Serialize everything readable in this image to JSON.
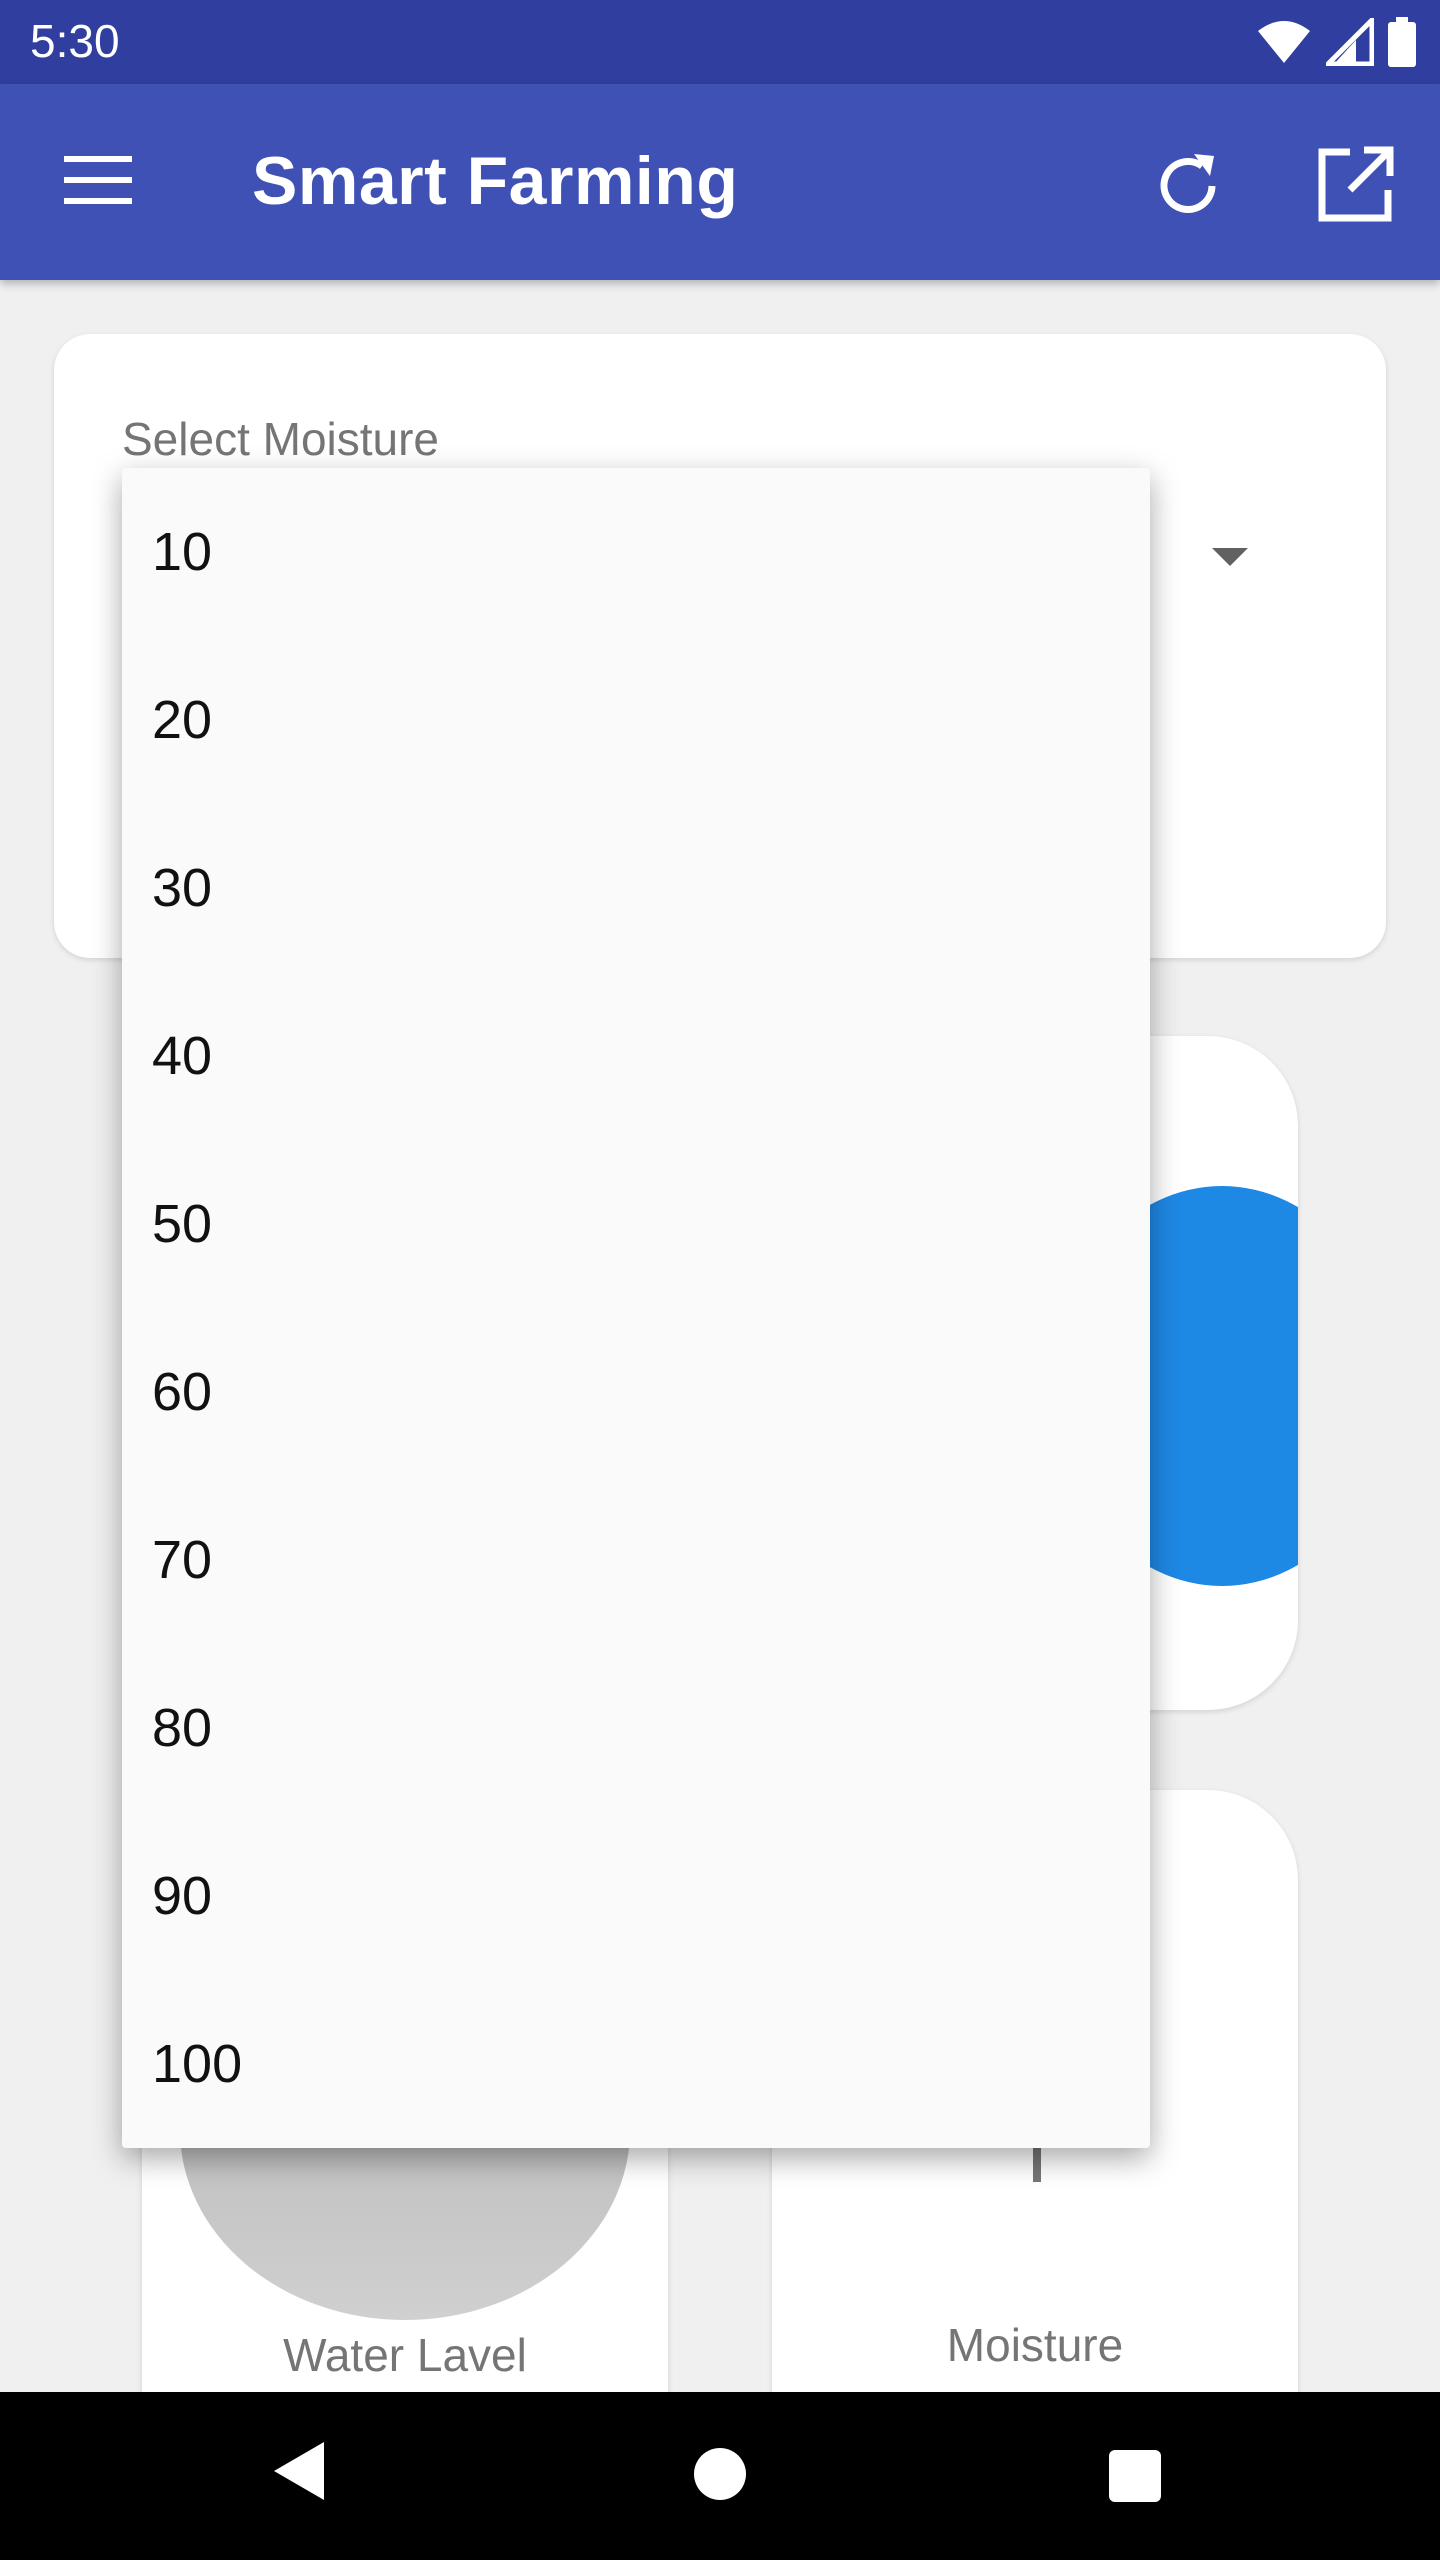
{
  "status_bar": {
    "time": "5:30",
    "icons": [
      "wifi-icon",
      "signal-icon",
      "battery-icon"
    ]
  },
  "app_bar": {
    "title": "Smart Farming",
    "icons": [
      "menu-icon",
      "refresh-icon",
      "open-in-new-icon"
    ],
    "background": "#3f51b5"
  },
  "moisture_select": {
    "label": "Select Moisture"
  },
  "dropdown": {
    "options": [
      "10",
      "20",
      "30",
      "40",
      "50",
      "60",
      "70",
      "80",
      "90",
      "100"
    ]
  },
  "tiles": {
    "water_label": "Water Lavel",
    "moisture_label": "Moisture"
  },
  "colors": {
    "status_bar": "#303f9f",
    "primary": "#3f51b5",
    "accent_blue": "#1e88e5"
  },
  "nav_bar": {
    "icons": [
      "back-icon",
      "home-icon",
      "recents-icon"
    ]
  }
}
